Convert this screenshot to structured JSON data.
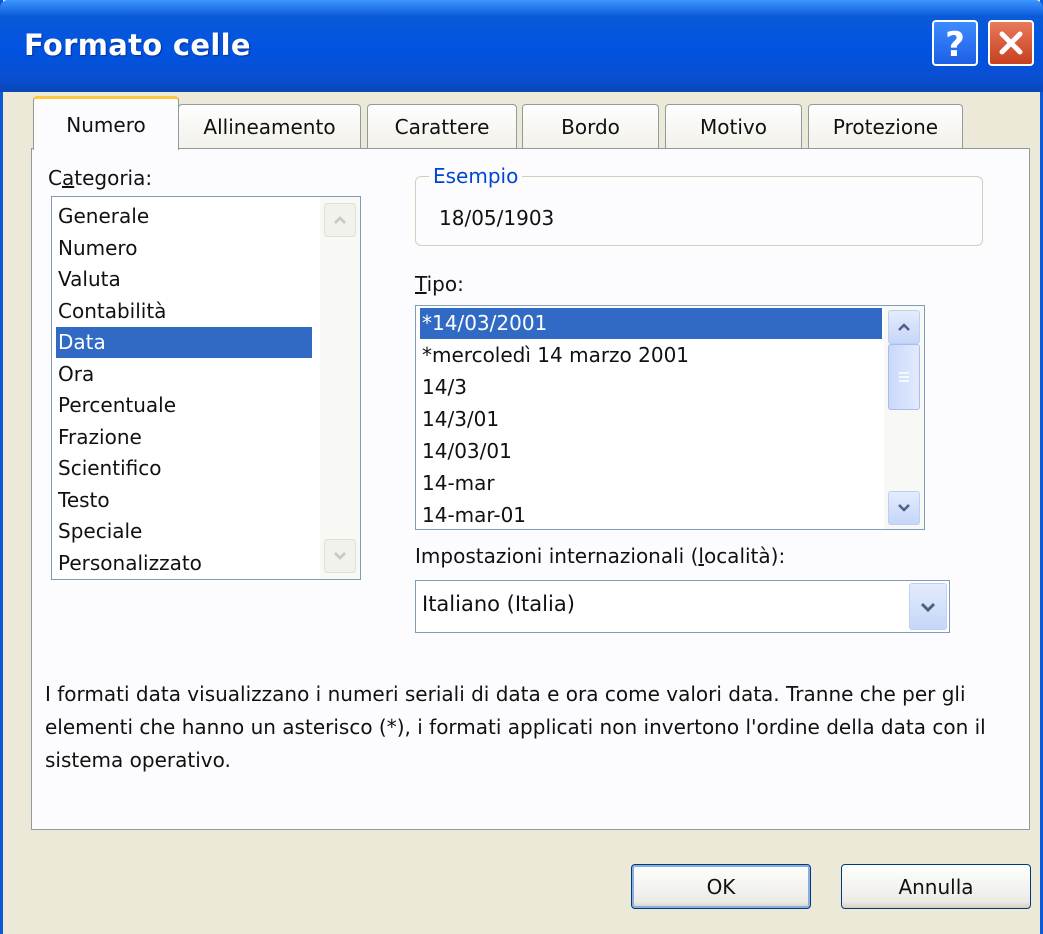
{
  "window": {
    "title": "Formato celle"
  },
  "tabs": [
    {
      "label": "Numero",
      "active": true
    },
    {
      "label": "Allineamento",
      "active": false
    },
    {
      "label": "Carattere",
      "active": false
    },
    {
      "label": "Bordo",
      "active": false
    },
    {
      "label": "Motivo",
      "active": false
    },
    {
      "label": "Protezione",
      "active": false
    }
  ],
  "category": {
    "label_pre": "C",
    "label_key": "a",
    "label_post": "tegoria:",
    "items": [
      "Generale",
      "Numero",
      "Valuta",
      "Contabilità",
      "Data",
      "Ora",
      "Percentuale",
      "Frazione",
      "Scientifico",
      "Testo",
      "Speciale",
      "Personalizzato"
    ],
    "selected": "Data"
  },
  "sample": {
    "legend": "Esempio",
    "value": "18/05/1903"
  },
  "type": {
    "label_key": "T",
    "label_post": "ipo:",
    "items": [
      "*14/03/2001",
      "*mercoledì 14 marzo 2001",
      "14/3",
      "14/3/01",
      "14/03/01",
      "14-mar",
      "14-mar-01"
    ],
    "selected": "*14/03/2001"
  },
  "locale": {
    "label_pre": "Impostazioni internazionali (",
    "label_key": "l",
    "label_post": "ocalità):",
    "value": "Italiano (Italia)"
  },
  "description": "I formati data visualizzano i numeri seriali di data e ora come valori data. Tranne che per gli elementi che hanno un asterisco (*), i formati applicati non invertono l'ordine della data con il sistema operativo.",
  "buttons": {
    "ok": "OK",
    "cancel": "Annulla"
  },
  "colors": {
    "titlebar": "#0a5ad8",
    "selection": "#316ac5",
    "tab_highlight": "#ffc83c",
    "dialog_bg": "#ece9d8"
  }
}
